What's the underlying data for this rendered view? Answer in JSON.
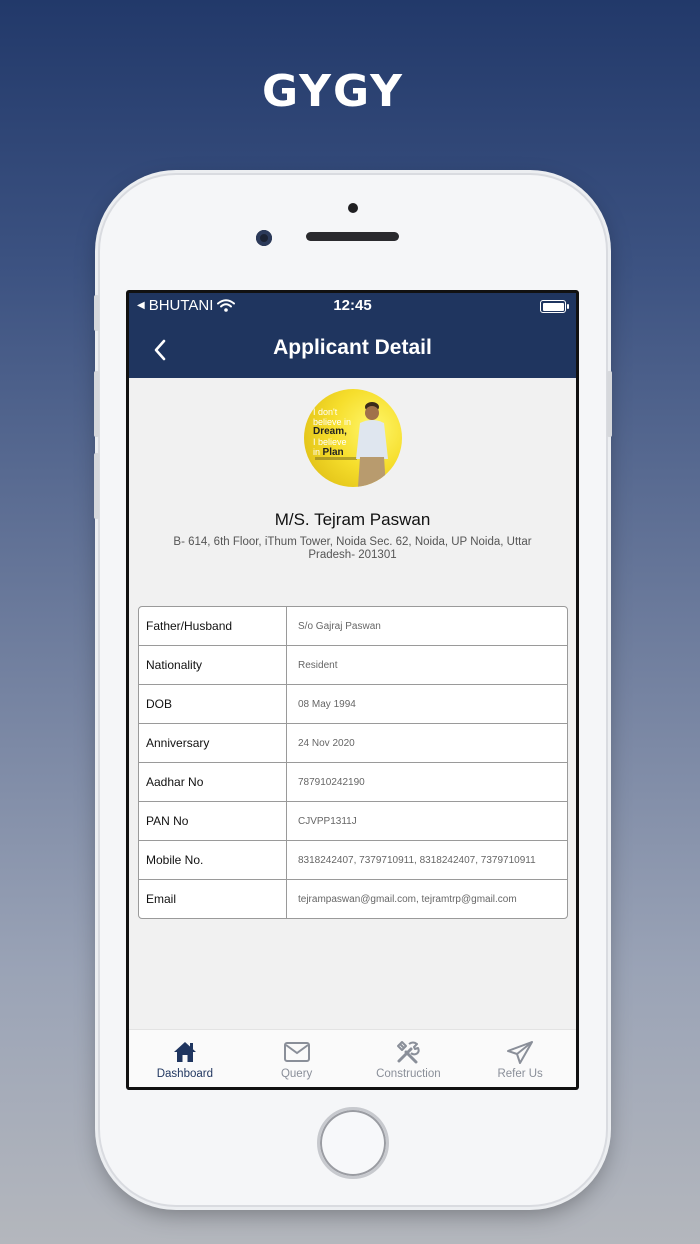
{
  "promo": {
    "title": "GYGY"
  },
  "status_bar": {
    "carrier": "BHUTANI",
    "time": "12:45"
  },
  "header": {
    "title": "Applicant Detail"
  },
  "applicant": {
    "avatar_quote": {
      "line1": "I don't",
      "line2": "believe in",
      "line3": "Dream,",
      "line4": "I believe",
      "line5": "in",
      "line6": "Plan"
    },
    "name": "M/S. Tejram  Paswan",
    "address": "B- 614, 6th Floor, iThum Tower, Noida Sec. 62, Noida, UP Noida, Uttar Pradesh- 201301"
  },
  "details": [
    {
      "label": "Father/Husband",
      "value": "S/o Gajraj Paswan"
    },
    {
      "label": "Nationality",
      "value": "Resident"
    },
    {
      "label": "DOB",
      "value": "08 May 1994"
    },
    {
      "label": "Anniversary",
      "value": "24 Nov 2020"
    },
    {
      "label": "Aadhar No",
      "value": "787910242190"
    },
    {
      "label": "PAN No",
      "value": "CJVPP1311J"
    },
    {
      "label": "Mobile No.",
      "value": "8318242407, 7379710911, 8318242407, 7379710911"
    },
    {
      "label": "Email",
      "value": "tejrampaswan@gmail.com, tejramtrp@gmail.com"
    }
  ],
  "tabbar": {
    "active_color": "#1f355f",
    "inactive_color": "#8a8f99",
    "tabs": [
      {
        "label": "Dashboard",
        "icon": "home-icon"
      },
      {
        "label": "Query",
        "icon": "mail-icon"
      },
      {
        "label": "Construction",
        "icon": "tools-icon"
      },
      {
        "label": "Refer Us",
        "icon": "send-icon"
      }
    ]
  }
}
